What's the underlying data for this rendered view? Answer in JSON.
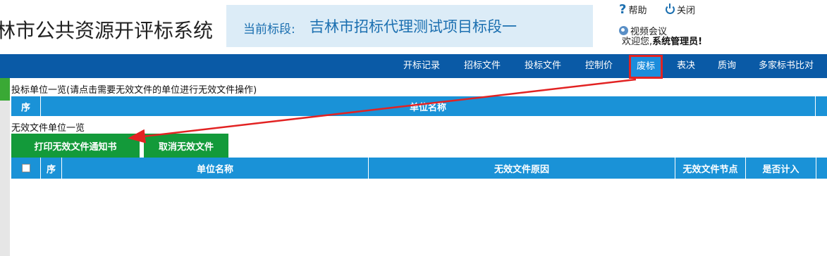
{
  "header": {
    "system_title": "林市公共资源开评标系统",
    "bid_label": "当前标段:",
    "bid_name": "吉林市招标代理测试项目标段一",
    "help": "帮助",
    "close": "关闭",
    "video_meeting": "视频会议",
    "welcome_prefix": "欢迎您,",
    "welcome_user": "系统管理员!"
  },
  "nav": {
    "items": [
      {
        "label": "开标记录"
      },
      {
        "label": "招标文件"
      },
      {
        "label": "投标文件"
      },
      {
        "label": "控制价"
      },
      {
        "label": "废标"
      },
      {
        "label": "表决"
      },
      {
        "label": "质询"
      },
      {
        "label": "多家标书比对"
      }
    ],
    "active_index": 4
  },
  "bidders": {
    "title": "投标单位一览(请点击需要无效文件的单位进行无效文件操作)",
    "columns": [
      "序",
      "单位名称"
    ]
  },
  "invalid": {
    "title": "无效文件单位一览",
    "print_button": "打印无效文件通知书",
    "cancel_button": "取消无效文件",
    "columns": [
      "序",
      "单位名称",
      "无效文件原因",
      "无效文件节点",
      "是否计入"
    ]
  },
  "colors": {
    "nav_bg": "#0a5aa6",
    "active_tab": "#1c8ddc",
    "table_head": "#1a92d7",
    "button_green": "#139a3a",
    "annotation_red": "#e22222"
  }
}
